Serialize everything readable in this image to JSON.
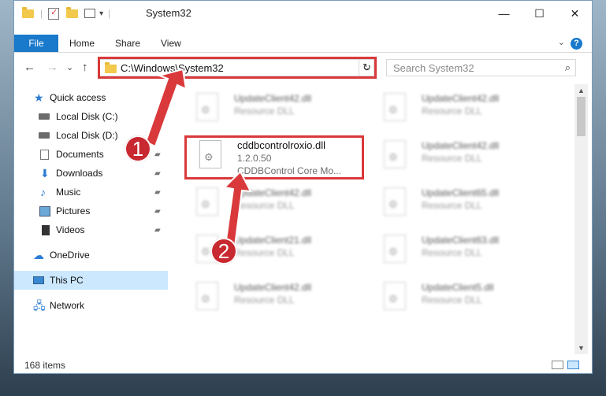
{
  "titlebar": {
    "title": "System32",
    "minimize": "—",
    "maximize": "☐",
    "close": "✕"
  },
  "ribbon": {
    "tabs": [
      "File",
      "Home",
      "Share",
      "View"
    ],
    "expand_glyph": "⌄",
    "help_glyph": "?"
  },
  "nav": {
    "back_glyph": "←",
    "forward_glyph": "→",
    "recent_glyph": "⌄",
    "up_glyph": "↑",
    "address_path": "C:\\Windows\\System32",
    "address_dropdown_glyph": "⌄",
    "refresh_glyph": "↻",
    "search_placeholder": "Search System32",
    "search_glyph": "⌕"
  },
  "sidebar": {
    "items": [
      {
        "label": "Quick access",
        "icon": "star-icon",
        "pinned": false
      },
      {
        "label": "Local Disk (C:)",
        "icon": "drive-icon",
        "pinned": true
      },
      {
        "label": "Local Disk (D:)",
        "icon": "drive-icon",
        "pinned": true
      },
      {
        "label": "Documents",
        "icon": "documents-icon",
        "pinned": true
      },
      {
        "label": "Downloads",
        "icon": "downloads-icon",
        "pinned": true
      },
      {
        "label": "Music",
        "icon": "music-icon",
        "pinned": true
      },
      {
        "label": "Pictures",
        "icon": "pictures-icon",
        "pinned": true
      },
      {
        "label": "Videos",
        "icon": "videos-icon",
        "pinned": true
      },
      {
        "label": "OneDrive",
        "icon": "onedrive-icon",
        "pinned": false
      },
      {
        "label": "This PC",
        "icon": "this-pc-icon",
        "pinned": false,
        "selected": true
      },
      {
        "label": "Network",
        "icon": "network-icon",
        "pinned": false
      }
    ],
    "pin_glyph": "📌"
  },
  "files": {
    "left_column": [
      {
        "name": "UpdateClient42.dll",
        "type": "Resource DLL",
        "blurred": true
      },
      {
        "name": "cddbcontrolroxio.dll",
        "type": "1.2.0.50",
        "description": "CDDBControl Core Mo...",
        "blurred": false,
        "highlighted": true
      },
      {
        "name": "UpdateClient42.dll",
        "type": "Resource DLL",
        "blurred": true
      },
      {
        "name": "UpdateClient21.dll",
        "type": "Resource DLL",
        "blurred": true
      },
      {
        "name": "UpdateClient42.dll",
        "type": "Resource DLL",
        "blurred": true
      }
    ],
    "right_column": [
      {
        "name": "UpdateClient42.dll",
        "type": "Resource DLL",
        "blurred": true
      },
      {
        "name": "UpdateClient42.dll",
        "type": "Resource DLL",
        "blurred": true
      },
      {
        "name": "UpdateClient65.dll",
        "type": "Resource DLL",
        "blurred": true
      },
      {
        "name": "UpdateClient63.dll",
        "type": "Resource DLL",
        "blurred": true
      },
      {
        "name": "UpdateClient5.dll",
        "type": "Resource DLL",
        "blurred": true
      }
    ]
  },
  "callouts": {
    "step1": "1",
    "step2": "2",
    "color": "#d9393a"
  },
  "status": {
    "item_count": "168 items"
  },
  "colors": {
    "accent": "#1979ca",
    "selection": "#cce8ff",
    "highlight_red": "#d9393a"
  }
}
